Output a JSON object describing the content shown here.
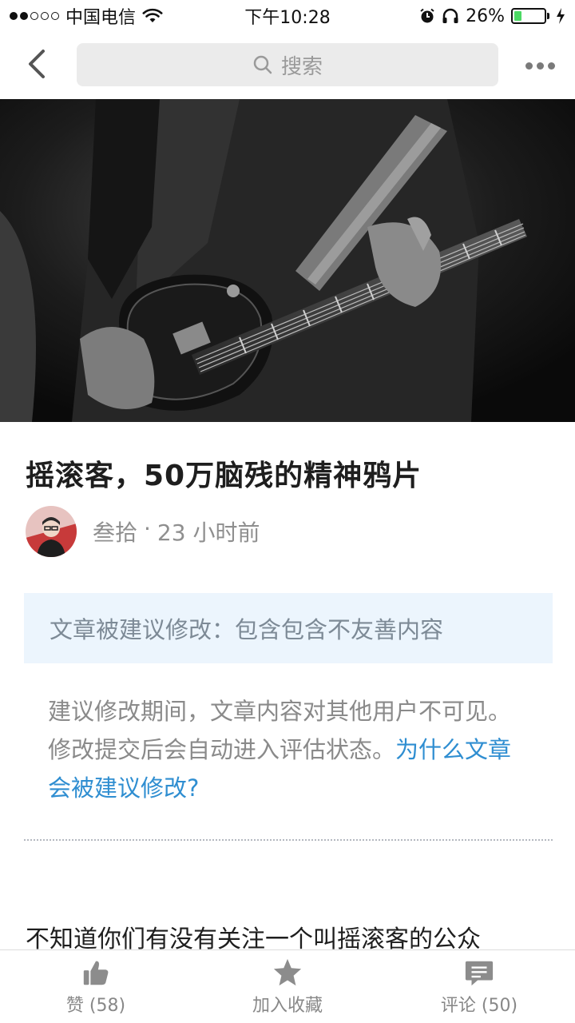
{
  "status_bar": {
    "carrier": "中国电信",
    "time": "下午10:28",
    "battery_percent": "26%",
    "battery_level": 0.26,
    "signal_bars_filled": 2,
    "signal_bars_total": 5
  },
  "nav": {
    "search_placeholder": "搜索"
  },
  "article": {
    "title": "摇滚客，50万脑残的精神鸦片",
    "author": "叁拾",
    "separator": "·",
    "time_ago": "23 小时前",
    "notice": "文章被建议修改：包含包含不友善内容",
    "explanation": "建议修改期间，文章内容对其他用户不可见。修改提交后会自动进入评估状态。",
    "explanation_link": "为什么文章会被建议修改?",
    "body_start": "不知道你们有没有关注一个叫摇滚客的公众"
  },
  "bottom_bar": {
    "like_label": "赞 (58)",
    "favorite_label": "加入收藏",
    "comment_label": "评论 (50)"
  },
  "colors": {
    "link": "#2f8ed1",
    "notice_bg": "#ecf5fd",
    "battery": "#4cd964"
  }
}
